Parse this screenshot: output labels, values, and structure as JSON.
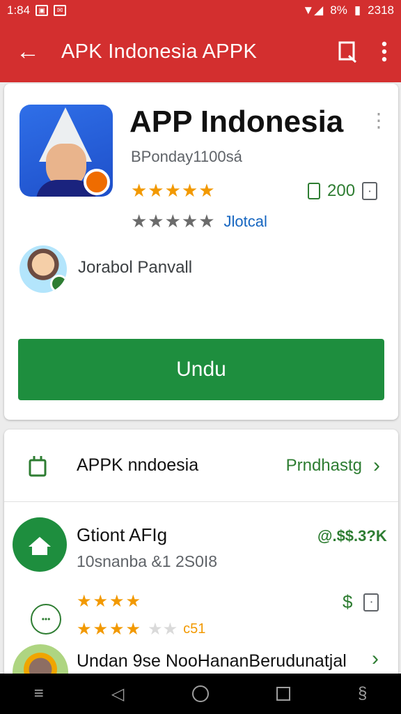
{
  "status_bar": {
    "time": "1:84",
    "signal_text": "8%",
    "battery_text": "2318"
  },
  "app_bar": {
    "title": "APK Indonesia  APPK"
  },
  "app": {
    "name": "APP Indonesia",
    "developer": "BPonday1100sá",
    "rating_half": "★",
    "downloads": "200",
    "rating_link": "Jlotcal"
  },
  "author": {
    "name": "Jorabol Panvall"
  },
  "install": {
    "label": "Undu"
  },
  "list": {
    "row1": {
      "label": "APPK nndoesia",
      "trail": "Prndhastg"
    },
    "promo": {
      "title": "Gtiont AFIg",
      "subtitle": "10snanba &1 2S0I8",
      "price": "@.$$.3?K"
    },
    "dollar": "$",
    "small_count": "c51",
    "bottom": {
      "label": "Undan 9se NooHananBerudunatjal"
    }
  },
  "colors": {
    "accent_red": "#d32f2f",
    "install_green": "#1e8e3e",
    "star_orange": "#f29900"
  }
}
